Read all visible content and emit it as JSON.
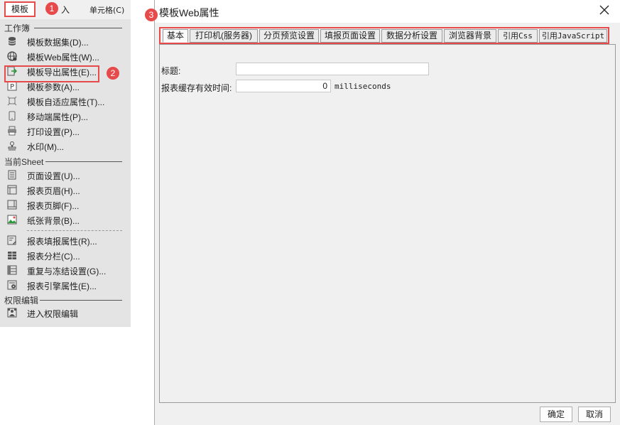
{
  "menubar": {
    "template_label": "模板",
    "insert_label": "入",
    "cell_label": "单元格(C)"
  },
  "badges": [
    "1",
    "2",
    "3"
  ],
  "menu": {
    "workbook_header": "工作簿",
    "workbook_items": [
      {
        "label": "模板数据集(D)...",
        "icon": "database-icon"
      },
      {
        "label": "模板Web属性(W)...",
        "icon": "globe-icon"
      },
      {
        "label": "模板导出属性(E)...",
        "icon": "export-icon"
      },
      {
        "label": "模板参数(A)...",
        "icon": "parameter-icon"
      },
      {
        "label": "模板自适应属性(T)...",
        "icon": "adaptive-icon"
      },
      {
        "label": "移动端属性(P)...",
        "icon": "mobile-icon"
      },
      {
        "label": "打印设置(P)...",
        "icon": "printer-icon"
      },
      {
        "label": "水印(M)...",
        "icon": "stamp-icon"
      }
    ],
    "sheet_header": "当前Sheet",
    "sheet_items": [
      {
        "label": "页面设置(U)...",
        "icon": "page-setup-icon"
      },
      {
        "label": "报表页眉(H)...",
        "icon": "header-icon"
      },
      {
        "label": "报表页脚(F)...",
        "icon": "footer-icon"
      },
      {
        "label": "纸张背景(B)...",
        "icon": "image-icon"
      },
      {
        "label": "报表填报属性(R)...",
        "icon": "form-icon"
      },
      {
        "label": "报表分栏(C)...",
        "icon": "columns-icon"
      },
      {
        "label": "重复与冻结设置(G)...",
        "icon": "freeze-icon"
      },
      {
        "label": "报表引擎属性(E)...",
        "icon": "engine-icon"
      }
    ],
    "permission_header": "权限编辑",
    "permission_items": [
      {
        "label": "进入权限编辑",
        "icon": "permission-icon"
      }
    ]
  },
  "dialog": {
    "title": "模板Web属性",
    "tabs": [
      {
        "label": "基本",
        "active": true
      },
      {
        "label": "打印机(服务器)",
        "active": false
      },
      {
        "label": "分页预览设置",
        "active": false
      },
      {
        "label": "填报页面设置",
        "active": false
      },
      {
        "label": "数据分析设置",
        "active": false
      },
      {
        "label": "浏览器背景",
        "active": false
      },
      {
        "label": "引用Css",
        "active": false
      },
      {
        "label": "引用JavaScript",
        "active": false
      }
    ],
    "fields": {
      "title_label": "标题:",
      "title_value": "",
      "cache_label": "报表缓存有效时间:",
      "cache_value": "0",
      "cache_unit": "milliseconds"
    },
    "ok_label": "确定",
    "cancel_label": "取消"
  },
  "colors": {
    "highlight": "#e64a4a"
  }
}
